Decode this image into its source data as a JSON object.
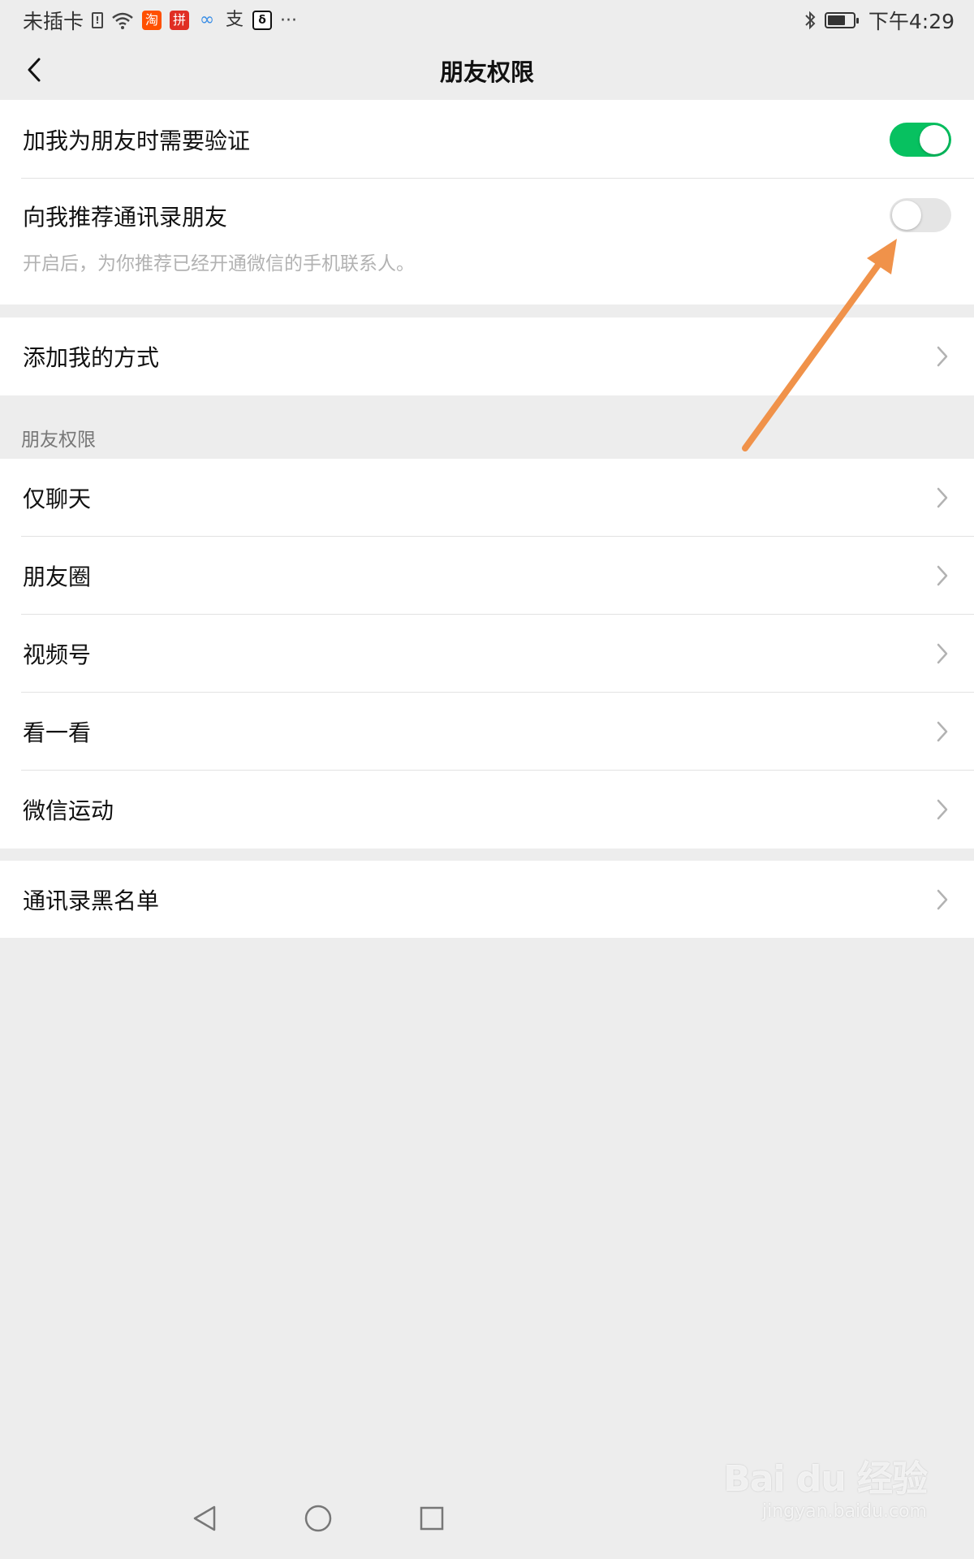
{
  "status_bar": {
    "carrier": "未插卡",
    "time": "下午4:29",
    "icons": [
      "sim-alert-icon",
      "wifi-icon",
      "taobao-app-icon",
      "pinduoduo-app-icon",
      "cloud-app-icon",
      "zhi-app-icon",
      "tiktok-app-icon",
      "more-dots-icon",
      "bluetooth-icon",
      "battery-icon"
    ],
    "app_glyphs": {
      "taobao": "淘",
      "pdd": "拼",
      "cloud": "∞",
      "zhi": "支",
      "tt": "δ",
      "more": "···",
      "sim": "!"
    }
  },
  "navbar": {
    "title": "朋友权限",
    "back_icon": "chevron-left-icon"
  },
  "settings": {
    "verify": {
      "label": "加我为朋友时需要验证",
      "enabled": true
    },
    "recommend": {
      "label": "向我推荐通讯录朋友",
      "hint": "开启后，为你推荐已经开通微信的手机联系人。",
      "enabled": false
    },
    "add_methods": {
      "label": "添加我的方式"
    }
  },
  "friend_permissions": {
    "header": "朋友权限",
    "items": [
      {
        "label": "仅聊天"
      },
      {
        "label": "朋友圈"
      },
      {
        "label": "视频号"
      },
      {
        "label": "看一看"
      },
      {
        "label": "微信运动"
      }
    ]
  },
  "blacklist": {
    "label": "通讯录黑名单"
  },
  "colors": {
    "toggle_on": "#07c160",
    "toggle_off": "#e5e5e5",
    "background": "#ededed",
    "annotation_arrow": "#f0924a"
  },
  "watermark": {
    "logo": "Bai du 经验",
    "url": "jingyan.baidu.com"
  }
}
